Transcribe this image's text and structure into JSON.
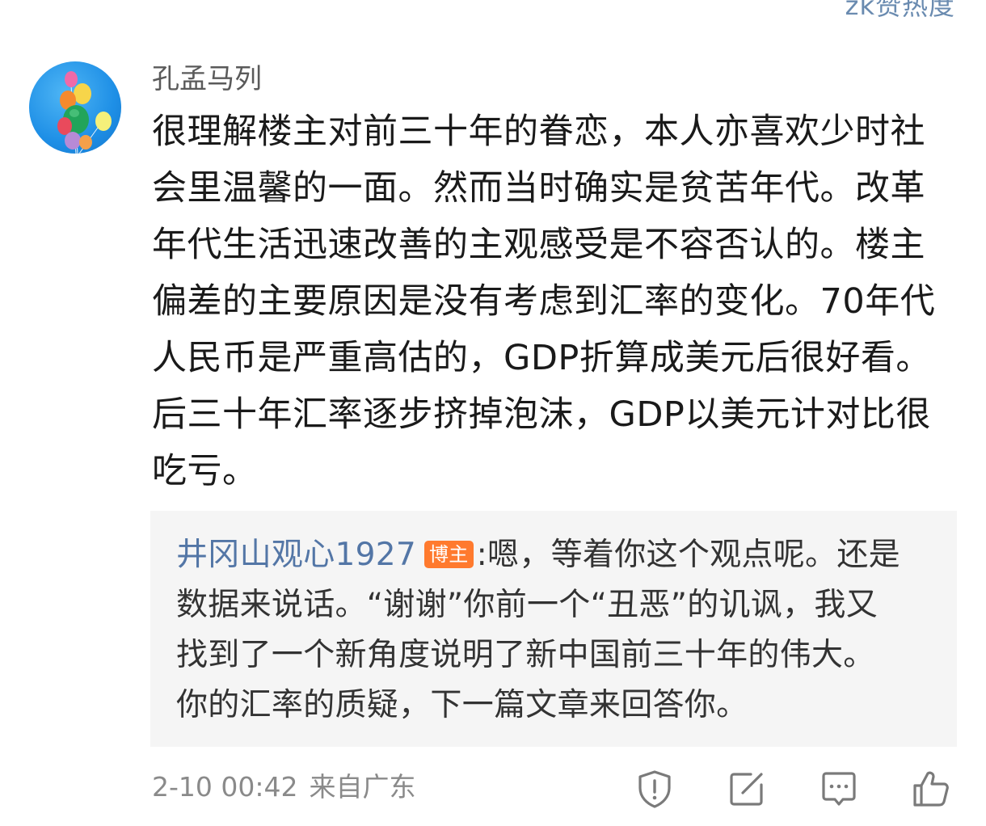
{
  "header": {
    "partial_text": "zk赞热度"
  },
  "comment": {
    "username": "孔孟马列",
    "text": "很理解楼主对前三十年的眷恋，本人亦喜欢少时社会里温馨的一面。然而当时确实是贫苦年代。改革年代生活迅速改善的主观感受是不容否认的。楼主偏差的主要原因是没有考虑到汇率的变化。70年代人民币是严重高估的，GDP折算成美元后很好看。后三十年汇率逐步挤掉泡沫，GDP以美元计对比很吃亏。",
    "time": "2-10 00:42",
    "location": "来自广东"
  },
  "reply": {
    "author": "井冈山观心1927",
    "badge": "博主",
    "separator": ":",
    "text": "嗯，等着你这个观点呢。还是数据来说话。“谢谢”你前一个“丑恶”的讥讽，我又找到了一个新角度说明了新中国前三十年的伟大。 你的汇率的质疑，下一篇文章来回答你。"
  },
  "actions": {
    "icons": [
      "report-shield-icon",
      "edit-icon",
      "reply-comment-icon",
      "like-thumb-icon"
    ]
  },
  "colors": {
    "author_link": "#5376a6",
    "badge_bg": "#ff7a2e",
    "reply_bg": "#f5f5f5",
    "meta_text": "#8a8a8a"
  }
}
